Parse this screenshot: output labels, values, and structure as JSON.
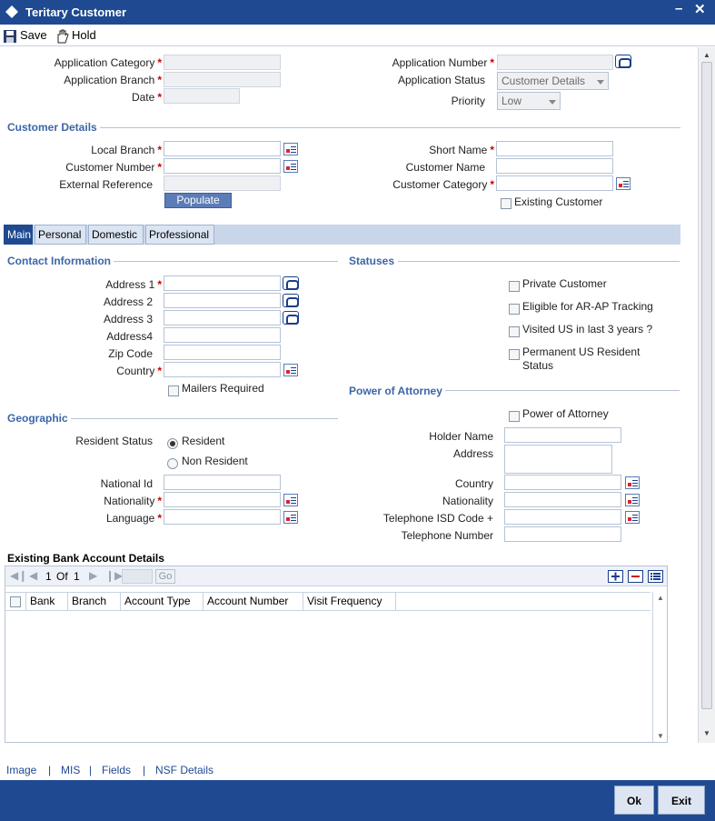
{
  "window": {
    "title": "Teritary Customer"
  },
  "toolbar": {
    "save": "Save",
    "hold": "Hold"
  },
  "application": {
    "category_label": "Application Category",
    "branch_label": "Application Branch",
    "date_label": "Date",
    "number_label": "Application Number",
    "status_label": "Application Status",
    "status_value": "Customer Details",
    "priority_label": "Priority",
    "priority_value": "Low"
  },
  "customer_details": {
    "section": "Customer Details",
    "local_branch": "Local Branch",
    "customer_number": "Customer Number",
    "external_reference": "External Reference",
    "populate": "Populate",
    "short_name": "Short Name",
    "customer_name": "Customer Name",
    "customer_category": "Customer Category",
    "existing_customer": "Existing Customer"
  },
  "tabs": [
    "Main",
    "Personal",
    "Domestic",
    "Professional"
  ],
  "contact": {
    "section": "Contact Information",
    "address1": "Address 1",
    "address2": "Address 2",
    "address3": "Address 3",
    "address4": "Address4",
    "zip": "Zip Code",
    "country": "Country",
    "mailers": "Mailers Required"
  },
  "statuses": {
    "section": "Statuses",
    "private": "Private Customer",
    "arap": "Eligible for AR-AP Tracking",
    "visited": "Visited US in last 3 years ?",
    "permanent": "Permanent US Resident Status"
  },
  "poa": {
    "section": "Power of Attorney",
    "checkbox": "Power of Attorney",
    "holder_name": "Holder Name",
    "address": "Address",
    "country": "Country",
    "nationality": "Nationality",
    "tel_isd": "Telephone ISD Code +",
    "tel_number": "Telephone Number"
  },
  "geographic": {
    "section": "Geographic",
    "resident_status": "Resident Status",
    "resident": "Resident",
    "non_resident": "Non Resident",
    "national_id": "National Id",
    "nationality": "Nationality",
    "language": "Language"
  },
  "bank_accounts": {
    "section": "Existing Bank Account Details",
    "page": "1",
    "of": "Of",
    "total": "1",
    "go": "Go",
    "columns": [
      "Bank",
      "Branch",
      "Account Type",
      "Account Number",
      "Visit Frequency"
    ]
  },
  "footer": {
    "links": [
      "Image",
      "MIS",
      "Fields",
      "NSF Details"
    ]
  },
  "buttons": {
    "ok": "Ok",
    "exit": "Exit"
  }
}
